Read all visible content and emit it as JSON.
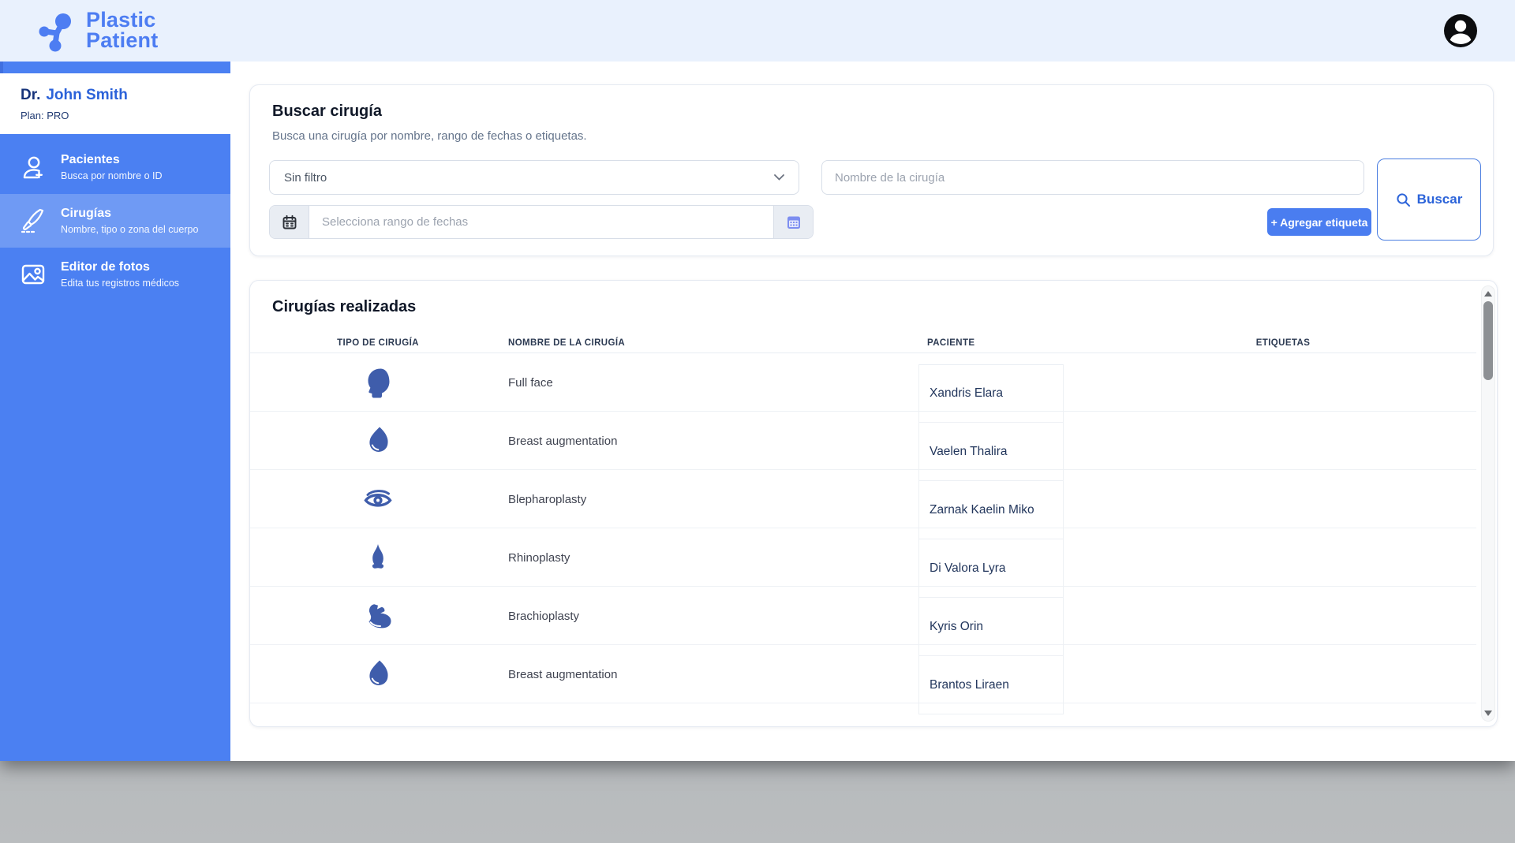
{
  "header": {
    "logo_line1": "Plastic",
    "logo_line2": "Patient"
  },
  "sidebar": {
    "doctor_prefix": "Dr.",
    "doctor_name": "John Smith",
    "plan": "Plan: PRO",
    "items": [
      {
        "label": "Pacientes",
        "sublabel": "Busca por nombre o ID",
        "icon": "patient-add-icon",
        "active": false
      },
      {
        "label": "Cirugías",
        "sublabel": "Nombre, tipo o zona del cuerpo",
        "icon": "scalpel-icon",
        "active": true
      },
      {
        "label": "Editor de fotos",
        "sublabel": "Edita tus registros médicos",
        "icon": "photo-icon",
        "active": false
      }
    ]
  },
  "search_card": {
    "title": "Buscar cirugía",
    "subtitle": "Busca una cirugía por nombre, rango de fechas o etiquetas.",
    "filter_value": "Sin filtro",
    "name_placeholder": "Nombre de la cirugía",
    "date_placeholder": "Selecciona rango de fechas",
    "add_tag_label": "+ Agregar etiqueta",
    "search_label": "Buscar"
  },
  "results_card": {
    "title": "Cirugías realizadas",
    "columns": {
      "tipo": "Tipo de cirugía",
      "nombre": "Nombre de la cirugía",
      "paciente": "Paciente",
      "etiquetas": "Etiquetas"
    },
    "rows": [
      {
        "type_icon": "head-icon",
        "surgery": "Full face",
        "patient": "Xandris Elara",
        "tags": ""
      },
      {
        "type_icon": "breast-icon",
        "surgery": "Breast augmentation",
        "patient": "Vaelen Thalira",
        "tags": ""
      },
      {
        "type_icon": "eye-icon",
        "surgery": "Blepharoplasty",
        "patient": "Zarnak Kaelin Miko",
        "tags": ""
      },
      {
        "type_icon": "nose-icon",
        "surgery": "Rhinoplasty",
        "patient": "Di Valora Lyra",
        "tags": ""
      },
      {
        "type_icon": "bicep-icon",
        "surgery": "Brachioplasty",
        "patient": "Kyris Orin",
        "tags": ""
      },
      {
        "type_icon": "breast-icon",
        "surgery": "Breast augmentation",
        "patient": "Brantos Liraen",
        "tags": ""
      }
    ]
  },
  "colors": {
    "accent_blue": "#4a7df0",
    "sidebar_blue": "#4b80f2",
    "sidebar_active": "#6f9af4",
    "header_bg": "#e9f1fd",
    "row_icon_blue": "#3f5dab",
    "link_blue": "#2b62d9"
  }
}
